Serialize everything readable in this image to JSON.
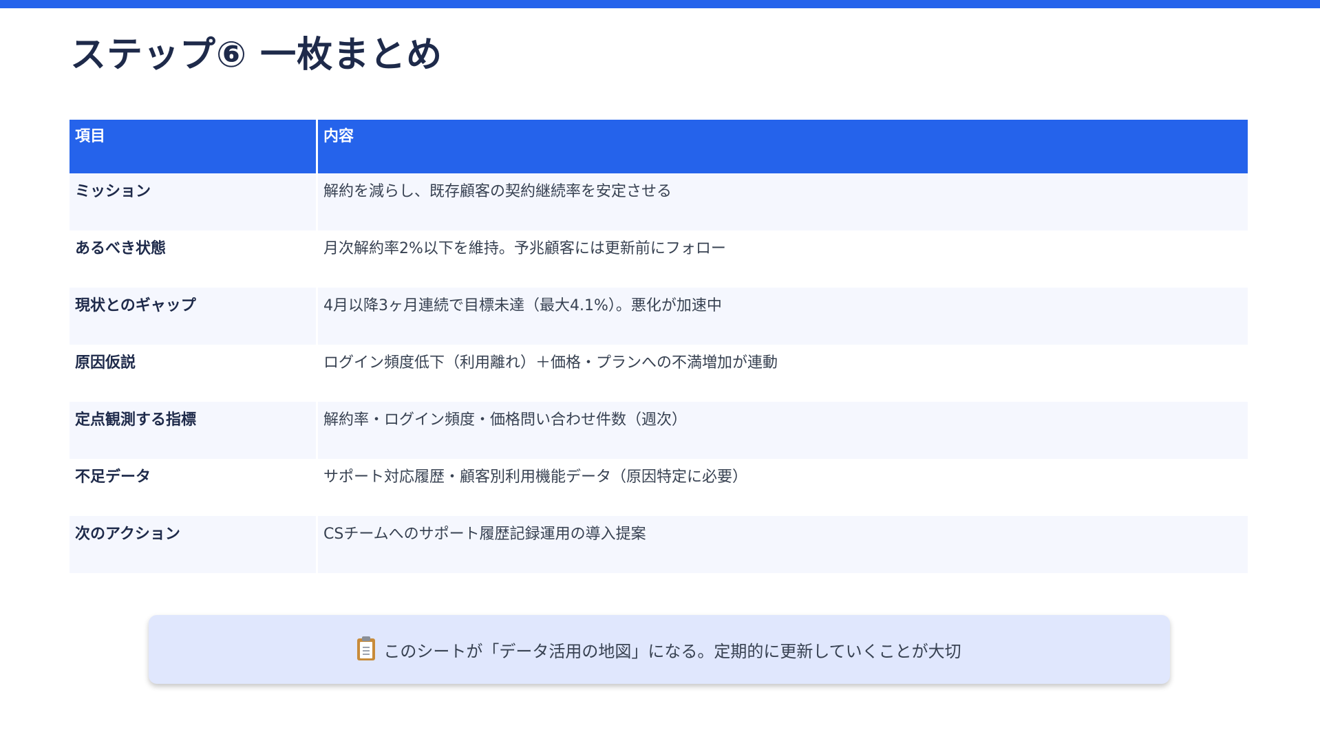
{
  "slide": {
    "title": "ステップ⑥ 一枚まとめ"
  },
  "table": {
    "headers": [
      "項目",
      "内容"
    ],
    "rows": [
      {
        "item": "ミッション",
        "content": "解約を減らし、既存顧客の契約継続率を安定させる"
      },
      {
        "item": "あるべき状態",
        "content": "月次解約率2%以下を維持。予兆顧客には更新前にフォロー"
      },
      {
        "item": "現状とのギャップ",
        "content": "4月以降3ヶ月連続で目標未達（最大4.1%）。悪化が加速中"
      },
      {
        "item": "原因仮説",
        "content": "ログイン頻度低下（利用離れ）＋価格・プランへの不満増加が連動"
      },
      {
        "item": "定点観測する指標",
        "content": "解約率・ログイン頻度・価格問い合わせ件数（週次）"
      },
      {
        "item": "不足データ",
        "content": "サポート対応履歴・顧客別利用機能データ（原因特定に必要）"
      },
      {
        "item": "次のアクション",
        "content": "CSチームへのサポート履歴記録運用の導入提案"
      }
    ]
  },
  "callout": {
    "icon": "clipboard-icon",
    "text": "このシートが「データ活用の地図」になる。定期的に更新していくことが大切"
  },
  "colors": {
    "accent": "#2563eb",
    "title": "#1e2a4a",
    "row_alt": "#f5f7fe",
    "callout_bg": "#e0e7fd"
  }
}
